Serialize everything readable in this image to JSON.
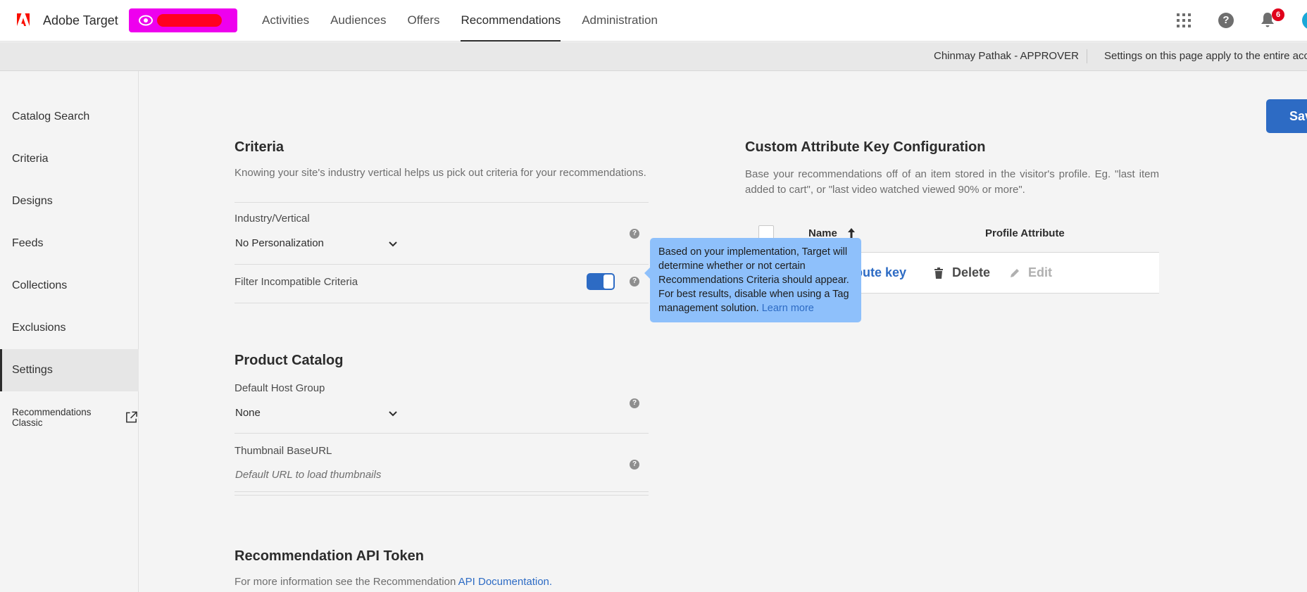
{
  "app": {
    "title": "Adobe Target"
  },
  "nav": {
    "items": [
      {
        "label": "Activities"
      },
      {
        "label": "Audiences"
      },
      {
        "label": "Offers"
      },
      {
        "label": "Recommendations"
      },
      {
        "label": "Administration"
      }
    ],
    "active": "Recommendations",
    "notification_count": "6"
  },
  "infobar": {
    "user": "Chinmay Pathak - APPROVER",
    "note": "Settings on this page apply to the entire acc"
  },
  "sidebar": {
    "items": [
      {
        "label": "Catalog Search"
      },
      {
        "label": "Criteria"
      },
      {
        "label": "Designs"
      },
      {
        "label": "Feeds"
      },
      {
        "label": "Collections"
      },
      {
        "label": "Exclusions"
      },
      {
        "label": "Settings"
      }
    ],
    "active": "Settings",
    "classic_label": "Recommendations Classic"
  },
  "criteria": {
    "title": "Criteria",
    "description": "Knowing your site's industry vertical helps us pick out criteria for your recommendations.",
    "industry_label": "Industry/Vertical",
    "industry_value": "No Personalization",
    "filter_label": "Filter Incompatible Criteria",
    "filter_enabled": true
  },
  "product_catalog": {
    "title": "Product Catalog",
    "host_group_label": "Default Host Group",
    "host_group_value": "None",
    "thumbnail_label": "Thumbnail BaseURL",
    "thumbnail_placeholder": "Default URL to load thumbnails"
  },
  "api_token": {
    "title": "Recommendation API Token",
    "description_prefix": "For more information see the Recommendation ",
    "link": "API Documentation."
  },
  "custom_attribute": {
    "title": "Custom Attribute Key Configuration",
    "description": "Base your recommendations off of an item stored in the visitor's profile. Eg. \"last item added to cart\", or \"last video watched viewed 90% or more\".",
    "col_name": "Name",
    "col_profile": "Profile Attribute",
    "add_partial": "ribute key",
    "delete_label": "Delete",
    "edit_label": "Edit"
  },
  "save_label": "Save",
  "tooltip": {
    "text": "Based on your implementation, Target will determine whether or not certain Recommendations Criteria should appear. For best results, disable when using a Tag management solution.",
    "link": "Learn more"
  },
  "colors": {
    "accent": "#2d6bc4",
    "workspace": "#ee00ee",
    "tooltip": "#8ec0fb",
    "adobe_red": "#fa0f00"
  }
}
